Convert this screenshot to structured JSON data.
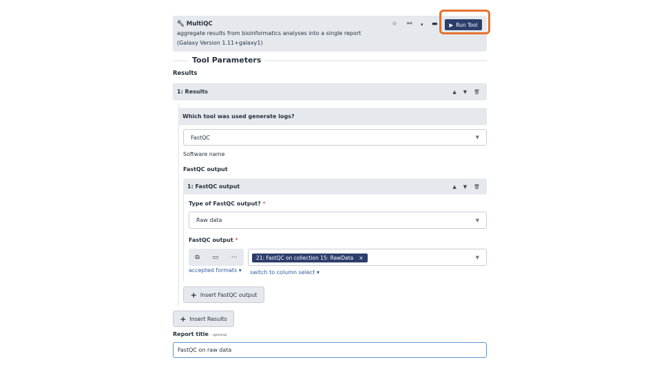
{
  "tool": {
    "name": "MultiQC",
    "description": "aggregate results from bioinformatics analyses into a single report",
    "version": "(Galaxy Version 1.11+galaxy1)",
    "run_label": "Run Tool"
  },
  "params_title": "Tool Parameters",
  "results_label": "Results",
  "results_section": "1: Results",
  "which_tool_label": "Which tool was used generate logs?",
  "software_value": "FastQC",
  "software_help": "Software name",
  "fastqc_output_label": "FastQC output",
  "fastqc_section": "1: FastQC output",
  "type_label": "Type of FastQC output?",
  "type_value": "Raw data",
  "output_label": "FastQC output",
  "selected_dataset": "21: FastQC on collection 15: RawData",
  "accepted_formats": "accepted formats ▾",
  "switch_column": "switch to column select ▾",
  "insert_fastqc": "Insert FastQC output",
  "insert_results": "Insert Results",
  "report_title_label": "Report title",
  "report_title_optional": "- optional",
  "report_title_value": "FastQC on raw data",
  "required_mark": "*",
  "colors": {
    "accent": "#2c3e6b",
    "highlight": "#e8702a",
    "panel": "#e5e8ed"
  }
}
